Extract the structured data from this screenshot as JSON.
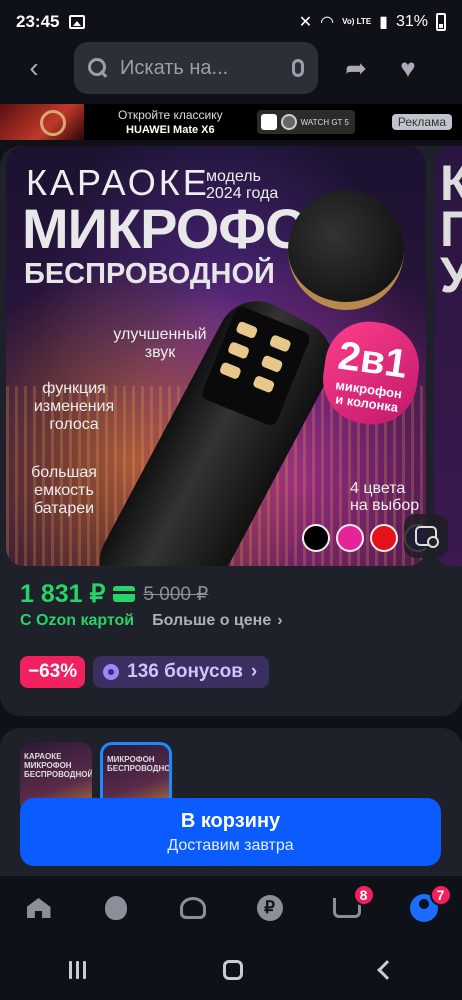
{
  "status_bar": {
    "time": "23:45",
    "network": "Vo) LTE",
    "battery": "31%",
    "icons": [
      "gallery-icon",
      "mute-icon",
      "wifi-icon",
      "signal-icon",
      "battery-icon"
    ]
  },
  "top_bar": {
    "search_placeholder": "Искать на...",
    "icons": [
      "back-arrow-icon",
      "search-icon",
      "mic-icon",
      "share-icon",
      "heart-icon"
    ]
  },
  "ad_banner": {
    "line1": "Откройте классику",
    "line2": "HUAWEI Mate X6",
    "watch_text": "WATCH GT 5",
    "label": "Реклама"
  },
  "gallery": {
    "title_top": "КАРАОКЕ",
    "model_line1": "модель",
    "model_line2": "2024 года",
    "title_main": "МИКРОФОН",
    "title_sub": "БЕСПРОВОДНОЙ",
    "feature1_line1": "улучшенный",
    "feature1_line2": "звук",
    "feature2_line1": "функция",
    "feature2_line2": "изменения",
    "feature2_line3": "голоса",
    "feature3_line1": "большая",
    "feature3_line2": "емкость",
    "feature3_line3": "батареи",
    "badge_big": "2в1",
    "badge_line1": "микрофон",
    "badge_line2": "и колонка",
    "colors_line1": "4 цвета",
    "colors_line2": "на выбор",
    "swatch_colors": [
      "#000000",
      "#e5249a",
      "#e3121b",
      "#1a1aa8"
    ],
    "next_image_letters": "К\nП\nУ"
  },
  "pricing": {
    "price": "1 831 ₽",
    "old_price": "5 000 ₽",
    "ozon_card_text": "С Ozon картой",
    "more_price_text": "Больше о цене",
    "discount": "−63%",
    "bonus_text": "136 бонусов",
    "price_color": "#28d36a",
    "discount_color": "#f0215e"
  },
  "variants": {
    "thumb1_text": "КАРАОКЕ\nМИКРОФОН\nБЕСПРОВОДНОЙ",
    "thumb2_text": "МИКРОФОН\nБЕСПРОВОДНОЙ"
  },
  "cart_button": {
    "label": "В корзину",
    "sublabel": "Доставим завтра",
    "color": "#0a5cff"
  },
  "bottom_nav": {
    "items": [
      {
        "icon": "home-icon"
      },
      {
        "icon": "fresh-icon"
      },
      {
        "icon": "catalog-icon"
      },
      {
        "icon": "ruble-icon",
        "glyph": "₽"
      },
      {
        "icon": "cart-icon",
        "badge": "8"
      },
      {
        "icon": "profile-icon",
        "badge": "7"
      }
    ]
  },
  "system_nav": {
    "icons": [
      "recents-icon",
      "home-icon",
      "back-icon"
    ]
  }
}
